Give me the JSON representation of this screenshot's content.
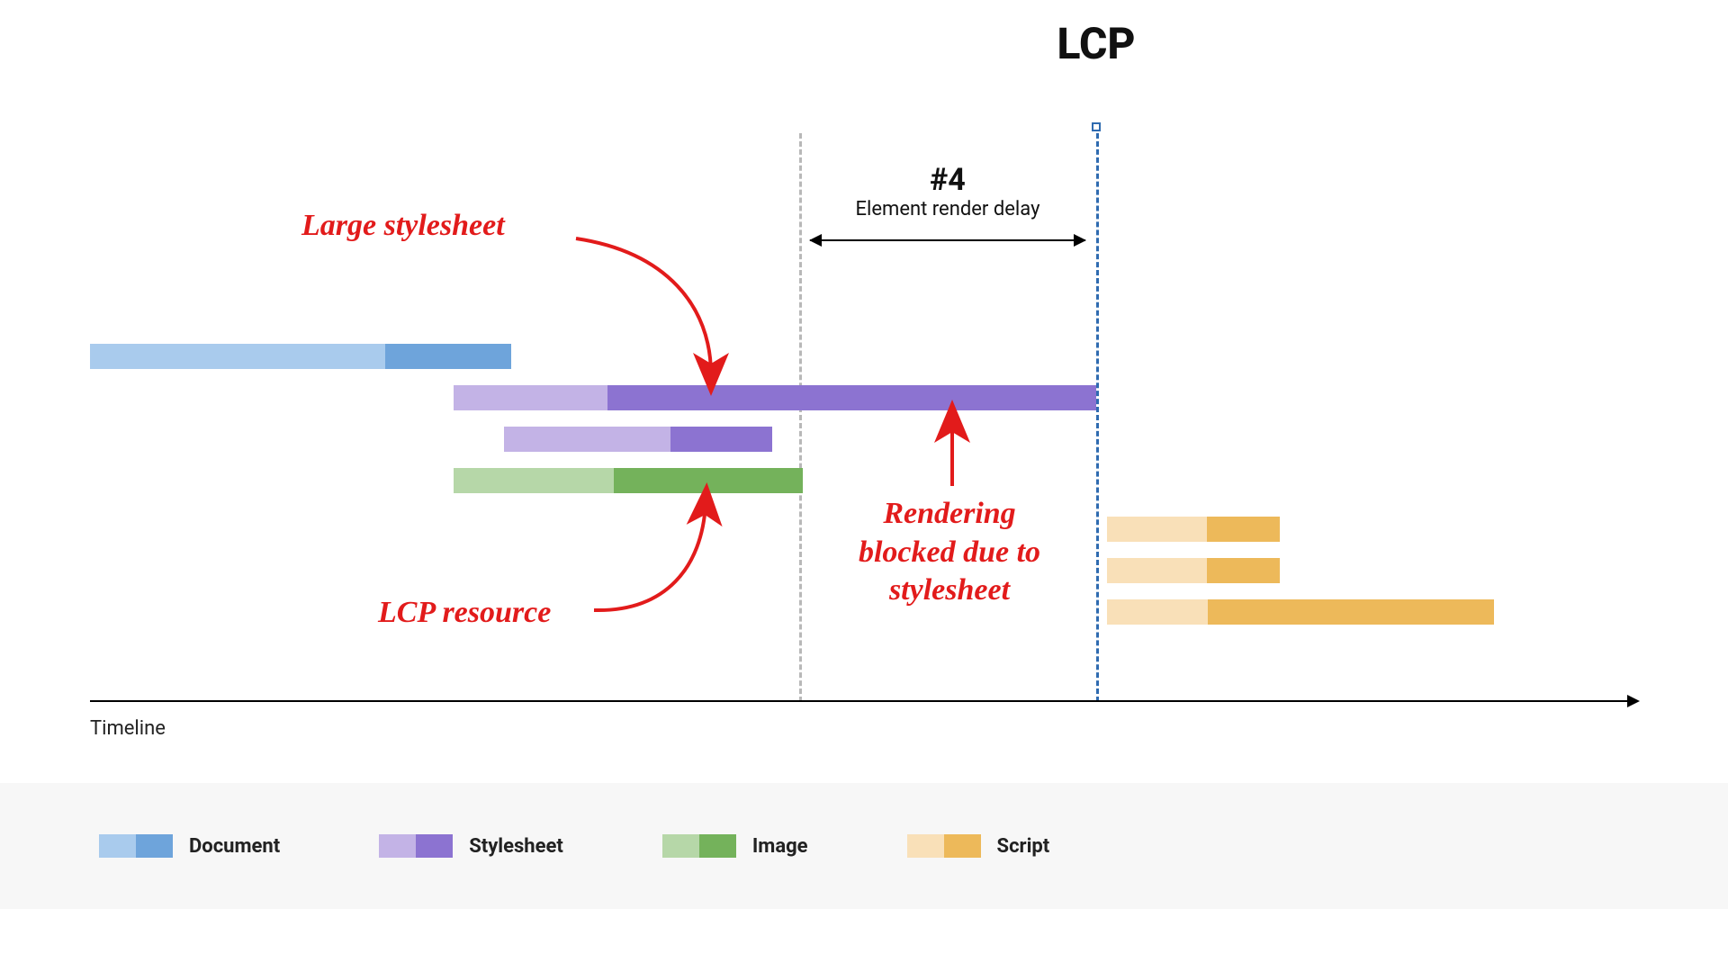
{
  "title": "LCP",
  "axis_label": "Timeline",
  "phase": {
    "num": "#4",
    "label": "Element render delay"
  },
  "annotations": {
    "large_stylesheet": "Large stylesheet",
    "lcp_resource": "LCP resource",
    "blocking_l1": "Rendering",
    "blocking_l2": "blocked due to",
    "blocking_l3": "stylesheet"
  },
  "legend": {
    "document": "Document",
    "stylesheet": "Stylesheet",
    "image": "Image",
    "script": "Script"
  },
  "colors": {
    "doc_light": "#a9cbed",
    "doc_dark": "#6ea4db",
    "sty_light": "#c3b3e6",
    "sty_dark": "#8c73d1",
    "img_light": "#b6d7a8",
    "img_dark": "#74b25b",
    "scr_light": "#f9e0b8",
    "scr_dark": "#edb95a",
    "gray_dash": "#b8b8b8",
    "blue_dash": "#2f6bb0",
    "red": "#e21b1b"
  },
  "chart_data": {
    "type": "bar",
    "xlabel": "Timeline",
    "x_range": [
      0,
      100
    ],
    "markers": {
      "render_start": 54,
      "lcp": 78
    },
    "phase_span": {
      "name": "#4 Element render delay",
      "start": 54,
      "end": 78
    },
    "bars": [
      {
        "row": 0,
        "type": "document",
        "start": 0,
        "light_end": 22,
        "end": 31
      },
      {
        "row": 1,
        "type": "stylesheet",
        "start": 27,
        "light_end": 39,
        "end": 78
      },
      {
        "row": 2,
        "type": "stylesheet",
        "start": 31,
        "light_end": 44,
        "end": 52
      },
      {
        "row": 3,
        "type": "image",
        "start": 27,
        "light_end": 39,
        "end": 54
      },
      {
        "row": 4,
        "type": "script",
        "start": 79,
        "light_end": 86.5,
        "end": 92
      },
      {
        "row": 5,
        "type": "script",
        "start": 79,
        "light_end": 86.5,
        "end": 92
      },
      {
        "row": 6,
        "type": "script",
        "start": 79,
        "light_end": 86.5,
        "end": 108
      }
    ],
    "annotations": [
      {
        "text": "Large stylesheet",
        "target_row": 1
      },
      {
        "text": "LCP resource",
        "target_row": 3
      },
      {
        "text": "Rendering blocked due to stylesheet",
        "target_row": 1,
        "region": "render-delay"
      }
    ]
  }
}
